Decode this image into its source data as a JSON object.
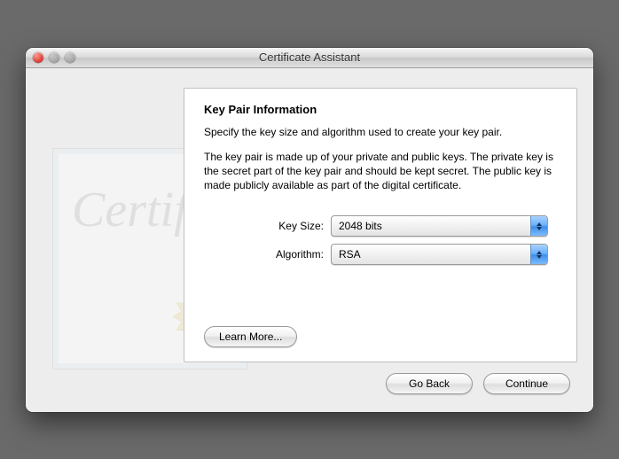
{
  "window": {
    "title": "Certificate Assistant"
  },
  "panel": {
    "heading": "Key Pair Information",
    "p1": "Specify the key size and algorithm used to create your key pair.",
    "p2": "The key pair is made up of your private and public keys. The private key is the secret part of the key pair and should be kept secret. The public key is made publicly available as part of the digital certificate.",
    "keysize_label": "Key Size:",
    "keysize_value": "2048 bits",
    "algorithm_label": "Algorithm:",
    "algorithm_value": "RSA",
    "learn_more": "Learn More..."
  },
  "footer": {
    "go_back": "Go Back",
    "continue": "Continue"
  },
  "cert_bg": {
    "signature": "Certif"
  }
}
